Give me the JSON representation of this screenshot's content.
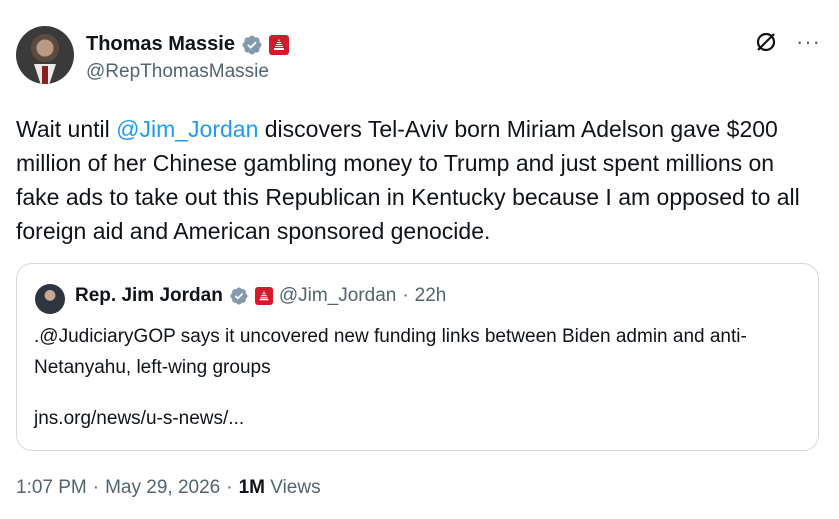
{
  "author": {
    "name": "Thomas Massie",
    "handle": "@RepThomasMassie"
  },
  "post": {
    "text_before": "Wait until ",
    "mention": "@Jim_Jordan",
    "text_after": " discovers Tel-Aviv born Miriam Adelson gave $200 million of her Chinese gambling money to Trump and just spent millions on fake ads to take out this Republican in Kentucky because I am opposed to all foreign aid and American sponsored genocide."
  },
  "quote": {
    "name": "Rep. Jim Jordan",
    "handle": "@Jim_Jordan",
    "separator": "·",
    "age": "22h",
    "text": ".@JudiciaryGOP says it uncovered new funding links between Biden admin and anti-Netanyahu, left-wing groups",
    "link": "jns.org/news/u-s-news/..."
  },
  "footer": {
    "time": "1:07 PM",
    "sep1": "·",
    "date": "May 29, 2026",
    "sep2": "·",
    "views_count": "1M",
    "views_label": "Views"
  },
  "colors": {
    "verified": "#829aab",
    "gov_badge": "#d11c2b",
    "mention": "#1d9bf0"
  },
  "icons": [
    "verified-badge-icon",
    "government-badge-icon",
    "grok-icon",
    "more-options-icon"
  ]
}
